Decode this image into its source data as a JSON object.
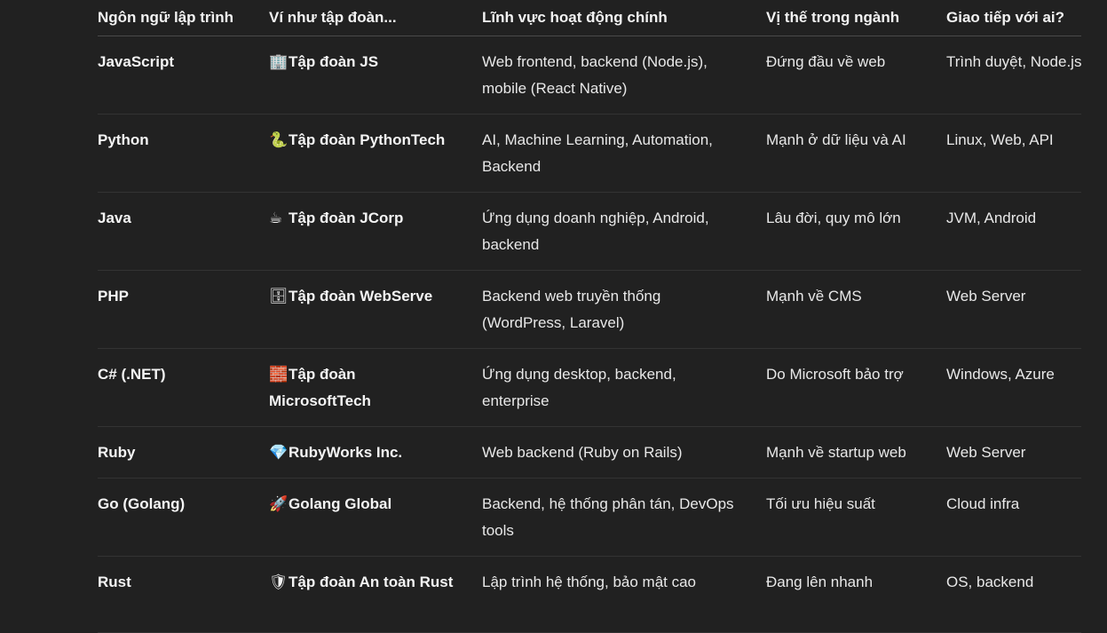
{
  "table": {
    "headers": [
      "Ngôn ngữ lập trình",
      "Ví như tập đoàn...",
      "Lĩnh vực hoạt động chính",
      "Vị thế trong ngành",
      "Giao tiếp với ai?"
    ],
    "rows": [
      {
        "language": "JavaScript",
        "corp_icon": "🏢",
        "corp": "Tập đoàn JS",
        "field": "Web frontend, backend (Node.js), mobile (React Native)",
        "position": "Đứng đầu về web",
        "communicates": "Trình duyệt, Node.js"
      },
      {
        "language": "Python",
        "corp_icon": "🐍",
        "corp": "Tập đoàn PythonTech",
        "field": "AI, Machine Learning, Automation, Backend",
        "position": "Mạnh ở dữ liệu và AI",
        "communicates": "Linux, Web, API"
      },
      {
        "language": "Java",
        "corp_icon": "☕",
        "corp": "Tập đoàn JCorp",
        "field": "Ứng dụng doanh nghiệp, Android, backend",
        "position": "Lâu đời, quy mô lớn",
        "communicates": "JVM, Android"
      },
      {
        "language": "PHP",
        "corp_icon": "🗄",
        "corp": "Tập đoàn WebServe",
        "field": "Backend web truyền thống (WordPress, Laravel)",
        "position": "Mạnh về CMS",
        "communicates": "Web Server"
      },
      {
        "language": "C# (.NET)",
        "corp_icon": "🧱",
        "corp": "Tập đoàn MicrosoftTech",
        "field": "Ứng dụng desktop, backend, enterprise",
        "position": "Do Microsoft bảo trợ",
        "communicates": "Windows, Azure"
      },
      {
        "language": "Ruby",
        "corp_icon": "💎",
        "corp": "RubyWorks Inc.",
        "field": "Web backend (Ruby on Rails)",
        "position": "Mạnh về startup web",
        "communicates": "Web Server"
      },
      {
        "language": "Go (Golang)",
        "corp_icon": "🚀",
        "corp": "Golang Global",
        "field": "Backend, hệ thống phân tán, DevOps tools",
        "position": "Tối ưu hiệu suất",
        "communicates": "Cloud infra"
      },
      {
        "language": "Rust",
        "corp_icon": "🛡",
        "corp": "Tập đoàn An toàn Rust",
        "field": "Lập trình hệ thống, bảo mật cao",
        "position": "Đang lên nhanh",
        "communicates": "OS, backend"
      }
    ]
  }
}
